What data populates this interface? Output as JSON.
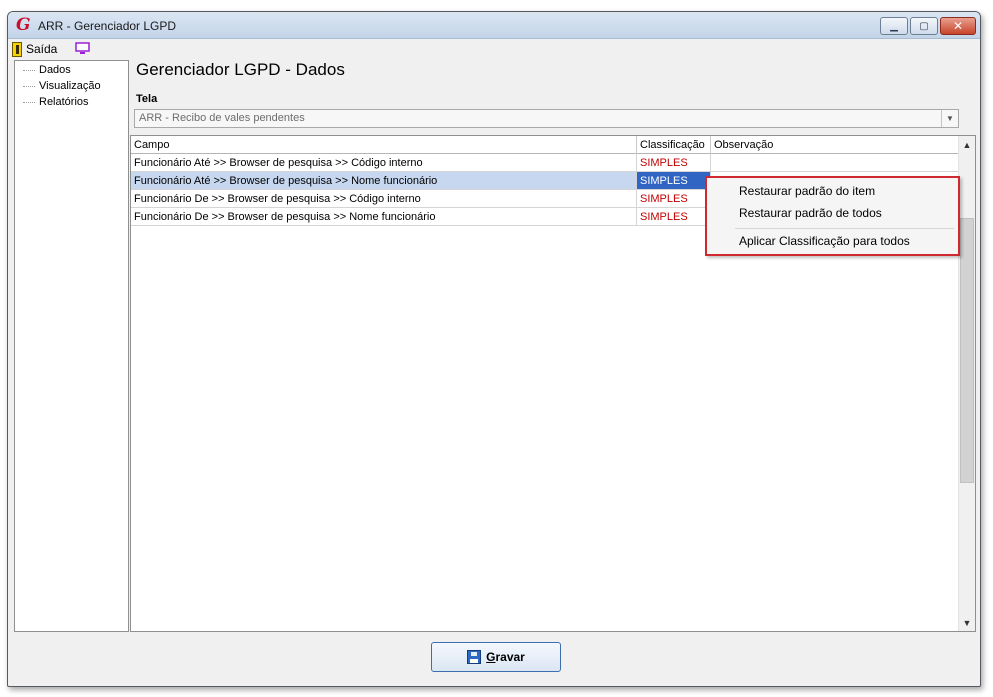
{
  "window": {
    "title": "ARR - Gerenciador LGPD"
  },
  "menubar": {
    "exit_label": "Saída"
  },
  "tree": {
    "items": [
      "Dados",
      "Visualização",
      "Relatórios"
    ]
  },
  "main": {
    "title": "Gerenciador LGPD - Dados",
    "tela_label": "Tela",
    "tela_value": "ARR - Recibo de vales pendentes"
  },
  "grid": {
    "headers": {
      "campo": "Campo",
      "classificacao": "Classificação",
      "observacao": "Observação"
    },
    "rows": [
      {
        "campo": "Funcionário Até >> Browser de pesquisa >> Código interno",
        "classificacao": "SIMPLES",
        "observacao": ""
      },
      {
        "campo": "Funcionário Até >> Browser de pesquisa >> Nome funcionário",
        "classificacao": "SIMPLES",
        "observacao": ""
      },
      {
        "campo": "Funcionário De >> Browser de pesquisa >> Código interno",
        "classificacao": "SIMPLES",
        "observacao": ""
      },
      {
        "campo": "Funcionário De >> Browser de pesquisa >> Nome funcionário",
        "classificacao": "SIMPLES",
        "observacao": ""
      }
    ],
    "selected_row": 1
  },
  "context_menu": {
    "items": [
      "Restaurar padrão do item",
      "Restaurar padrão de todos",
      "Aplicar Classificação para todos"
    ]
  },
  "footer": {
    "save_label": "Gravar"
  },
  "colors": {
    "classification_text": "#c00000",
    "selection": "#3165c4",
    "context_menu_border": "#d0282f"
  }
}
